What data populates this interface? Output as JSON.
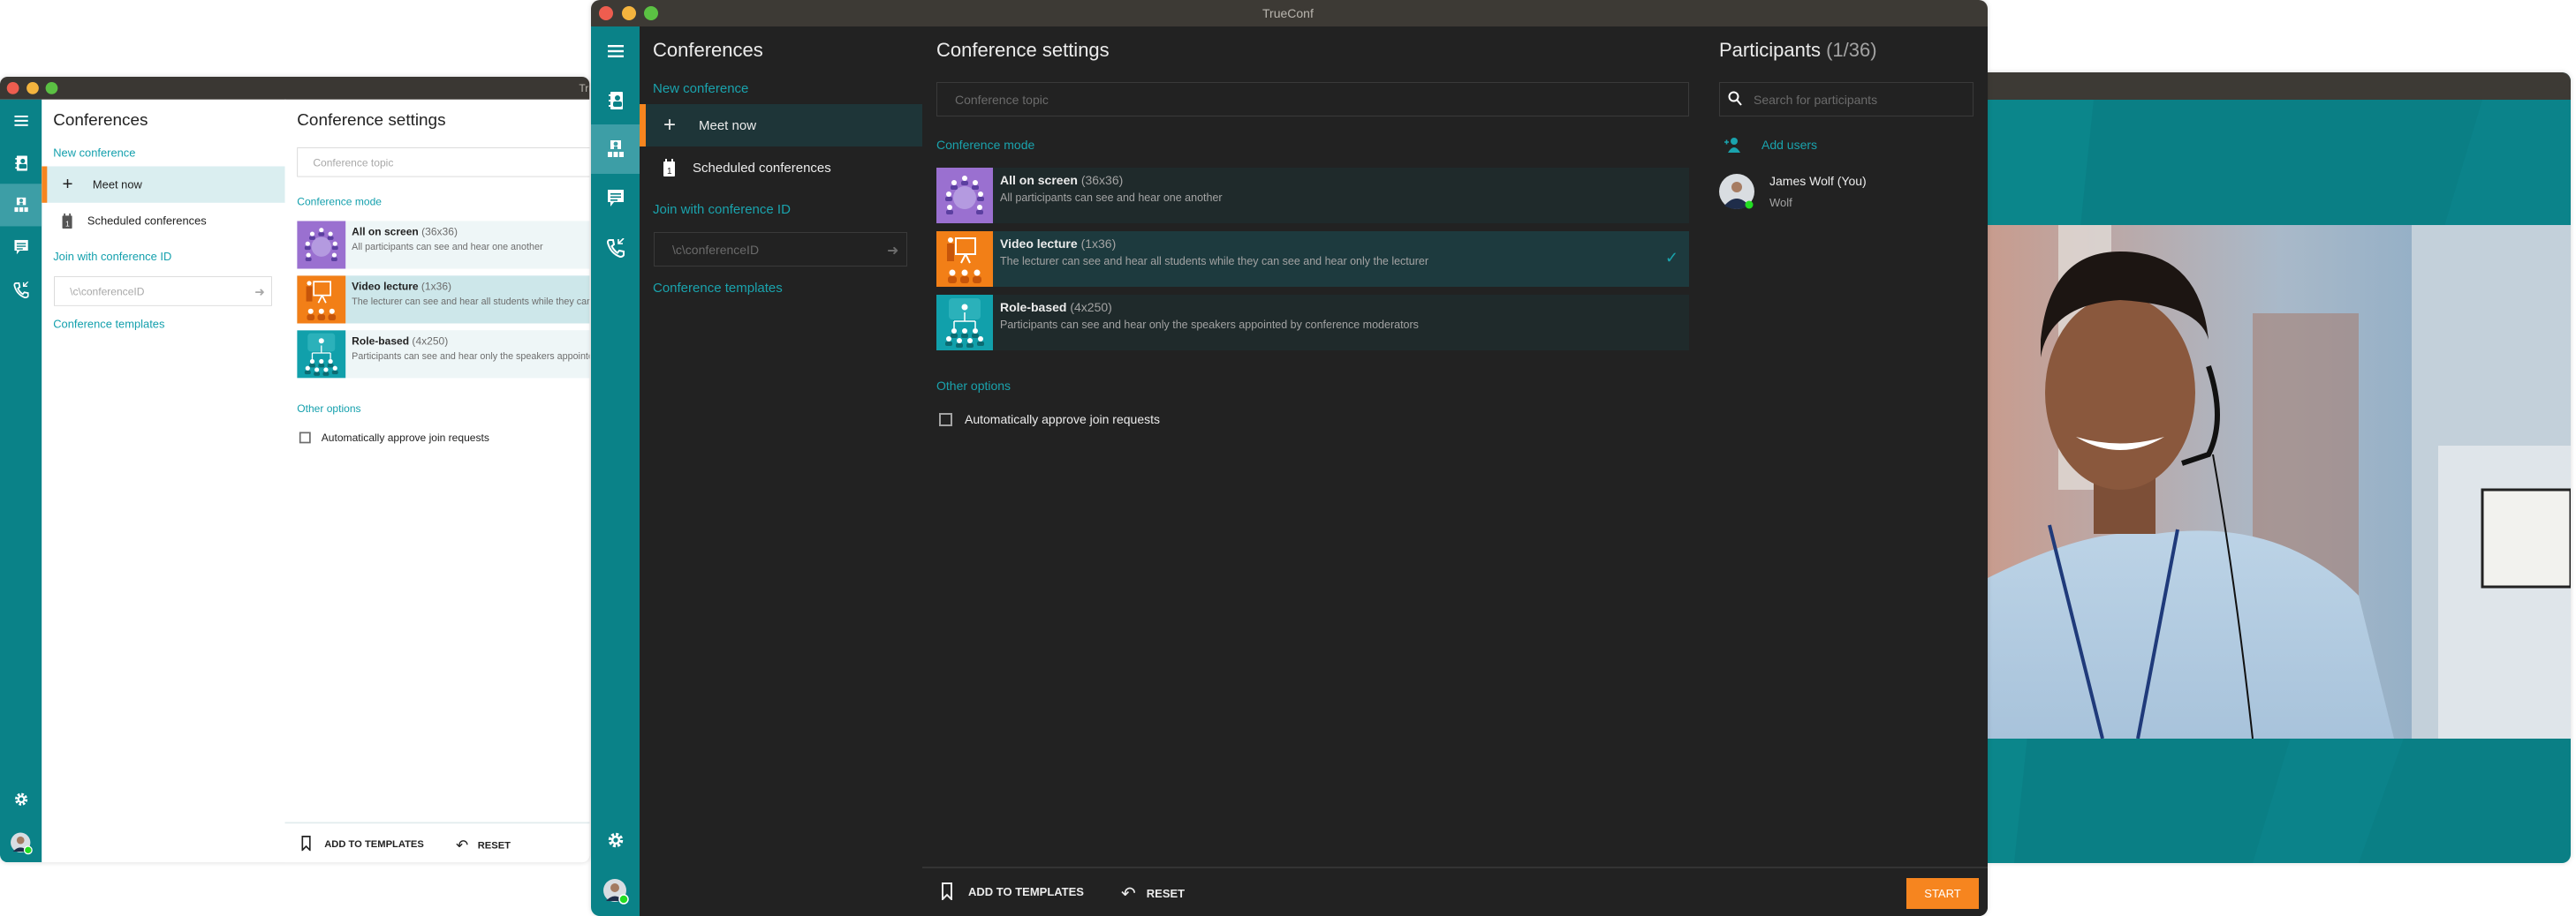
{
  "window_title": "TrueConf",
  "sidebar": {
    "items": [
      {
        "id": "menu",
        "icon": "hamburger-menu-icon"
      },
      {
        "id": "contacts",
        "icon": "address-book-icon"
      },
      {
        "id": "conferences",
        "icon": "conference-icon",
        "active": true
      },
      {
        "id": "chat",
        "icon": "chat-icon"
      },
      {
        "id": "calls",
        "icon": "call-history-icon"
      },
      {
        "id": "settings",
        "icon": "gear-icon"
      },
      {
        "id": "profile",
        "icon": "avatar-icon",
        "status": "online"
      }
    ]
  },
  "conferences": {
    "title": "Conferences",
    "new_conference": "New conference",
    "meet_now": "Meet now",
    "scheduled": "Scheduled conferences",
    "join_label": "Join with conference ID",
    "join_placeholder": "\\c\\conferenceID",
    "templates": "Conference templates"
  },
  "settings": {
    "title": "Conference settings",
    "topic_placeholder": "Conference topic",
    "mode_label": "Conference mode",
    "modes": [
      {
        "name": "All on screen",
        "capacity": "(36x36)",
        "description": "All participants can see and hear one another",
        "color": "#9a70d0",
        "selected": false
      },
      {
        "name": "Video lecture",
        "capacity": "(1x36)",
        "description": "The lecturer can see and hear all students while they can see and hear only the lecturer",
        "color": "#f27f17",
        "selected": true
      },
      {
        "name": "Role-based",
        "capacity": "(4x250)",
        "description": "Participants can see and hear only the speakers appointed by conference moderators",
        "color": "#11a0ab",
        "selected": false
      }
    ],
    "other_options": "Other options",
    "auto_approve": {
      "label": "Automatically approve join requests",
      "checked": false
    }
  },
  "participants": {
    "title": "Participants",
    "count": "(1/36)",
    "search_placeholder": "Search for participants",
    "add_users": "Add users",
    "list": [
      {
        "name": "James Wolf (You)",
        "login": "Wolf",
        "status": "online"
      }
    ]
  },
  "footer": {
    "add_to_templates": "ADD TO TEMPLATES",
    "reset": "RESET",
    "start": "START"
  },
  "colors": {
    "teal": "#0a8288",
    "accent": "#1aa3ad",
    "orange": "#f6851f",
    "online": "#22dd22"
  }
}
